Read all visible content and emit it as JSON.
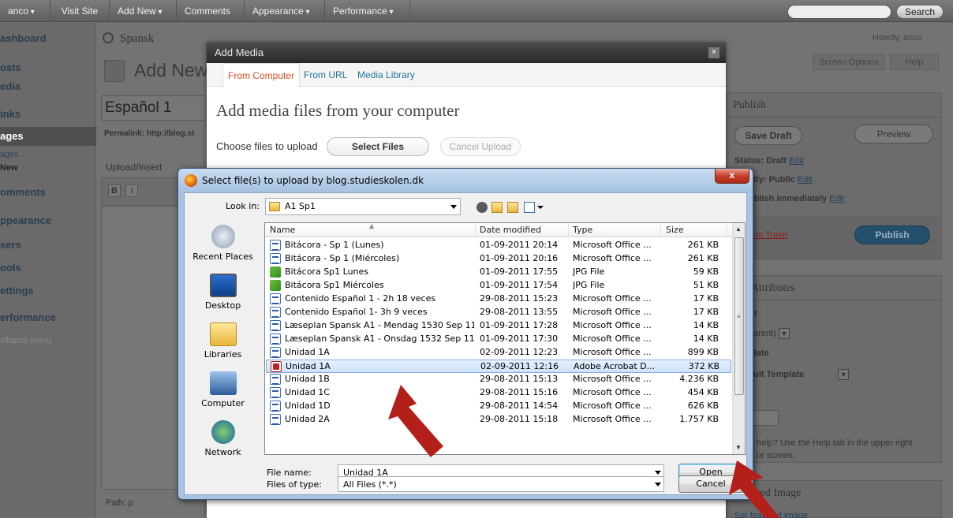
{
  "adminbar": {
    "user": "anco",
    "visit_site": "Visit Site",
    "add_new": "Add New",
    "comments": "Comments",
    "appearance": "Appearance",
    "performance": "Performance",
    "search_button": "Search"
  },
  "sidebar": {
    "items": [
      "ashboard",
      "osts",
      "edia",
      "inks",
      "ages",
      "ages",
      "New",
      "omments",
      "ppearance",
      "sers",
      "ools",
      "ettings",
      "erformance",
      "ollapse menu"
    ]
  },
  "wp": {
    "site_name": "Spansk",
    "howdy": "Howdy, anco",
    "page_heading": "Add New",
    "screen_options": "Screen Options",
    "help": "Help",
    "post_title": "Español 1",
    "permalink": "Permalink: http://blog.st",
    "upload_insert": "Upload/Insert",
    "path": "Path: p",
    "publish_box": {
      "title": "Publish",
      "save_draft": "Save Draft",
      "preview": "Preview",
      "status_label": "Status: Draft",
      "visibility_label": "ility: Public",
      "publish_label": "ublish immediately",
      "edit": "Edit",
      "trash": "e to Trash",
      "publish_button": "Publish"
    },
    "attributes_box": {
      "title": "e Attributes",
      "parent_label": "nt",
      "parent_value": "parent)",
      "template_label": "plate",
      "template_value": "ault Template",
      "order_label": "r",
      "help_text_1": "help? Use the Help tab in the upper right",
      "help_text_2": "ur screen."
    },
    "featured_box": {
      "title": "red Image",
      "link": "Set featured image"
    }
  },
  "addmedia": {
    "title": "Add Media",
    "close": "×",
    "tabs": [
      "From Computer",
      "From URL",
      "Media Library"
    ],
    "heading": "Add media files from your computer",
    "choose_label": "Choose files to upload",
    "select_button": "Select Files",
    "cancel_button": "Cancel Upload"
  },
  "filedialog": {
    "title": "Select file(s) to upload by blog.studieskolen.dk",
    "close": "x",
    "look_in_label": "Look in:",
    "look_in_value": "A1 Sp1",
    "places": [
      "Recent Places",
      "Desktop",
      "Libraries",
      "Computer",
      "Network"
    ],
    "columns": [
      "Name",
      "Date modified",
      "Type",
      "Size"
    ],
    "files": [
      {
        "name": "Bitácora - Sp 1 (Lunes)",
        "date": "01-09-2011 20:14",
        "type": "Microsoft Office ...",
        "size": "261 KB",
        "icon": "word"
      },
      {
        "name": "Bitácora - Sp 1 (Miércoles)",
        "date": "01-09-2011 20:16",
        "type": "Microsoft Office ...",
        "size": "261 KB",
        "icon": "word"
      },
      {
        "name": "Bitácora Sp1 Lunes",
        "date": "01-09-2011 17:55",
        "type": "JPG File",
        "size": "59 KB",
        "icon": "jpg"
      },
      {
        "name": "Bitácora Sp1 Miércoles",
        "date": "01-09-2011 17:54",
        "type": "JPG File",
        "size": "51 KB",
        "icon": "jpg"
      },
      {
        "name": "Contenido Español 1 - 2h 18 veces",
        "date": "29-08-2011 15:23",
        "type": "Microsoft Office ...",
        "size": "17 KB",
        "icon": "word"
      },
      {
        "name": "Contenido Español 1- 3h 9 veces",
        "date": "29-08-2011 13:55",
        "type": "Microsoft Office ...",
        "size": "17 KB",
        "icon": "word"
      },
      {
        "name": "Læseplan Spansk A1 - Mendag 1530 Sep 11",
        "date": "01-09-2011 17:28",
        "type": "Microsoft Office ...",
        "size": "14 KB",
        "icon": "word"
      },
      {
        "name": "Læseplan Spansk A1 - Onsdag 1532 Sep 11",
        "date": "01-09-2011 17:30",
        "type": "Microsoft Office ...",
        "size": "14 KB",
        "icon": "word"
      },
      {
        "name": "Unidad 1A",
        "date": "02-09-2011 12:23",
        "type": "Microsoft Office ...",
        "size": "899 KB",
        "icon": "word"
      },
      {
        "name": "Unidad 1A",
        "date": "02-09-2011 12:16",
        "type": "Adobe Acrobat D...",
        "size": "372 KB",
        "icon": "pdf",
        "selected": true
      },
      {
        "name": "Unidad 1B",
        "date": "29-08-2011 15:13",
        "type": "Microsoft Office ...",
        "size": "4.236 KB",
        "icon": "word"
      },
      {
        "name": "Unidad 1C",
        "date": "29-08-2011 15:16",
        "type": "Microsoft Office ...",
        "size": "454 KB",
        "icon": "word"
      },
      {
        "name": "Unidad 1D",
        "date": "29-08-2011 14:54",
        "type": "Microsoft Office ...",
        "size": "626 KB",
        "icon": "word"
      },
      {
        "name": "Unidad 2A",
        "date": "29-08-2011 15:18",
        "type": "Microsoft Office ...",
        "size": "1.757 KB",
        "icon": "word"
      }
    ],
    "file_name_label": "File name:",
    "file_name_value": "Unidad 1A",
    "files_of_type_label": "Files of type:",
    "files_of_type_value": "All Files (*.*)",
    "open_button": "Open",
    "cancel_button": "Cancel"
  },
  "colors": {
    "annotation_arrow": "#b3201a",
    "selection": "#cde2f8",
    "wp_link": "#21759b",
    "active_tab": "#d54e21"
  }
}
